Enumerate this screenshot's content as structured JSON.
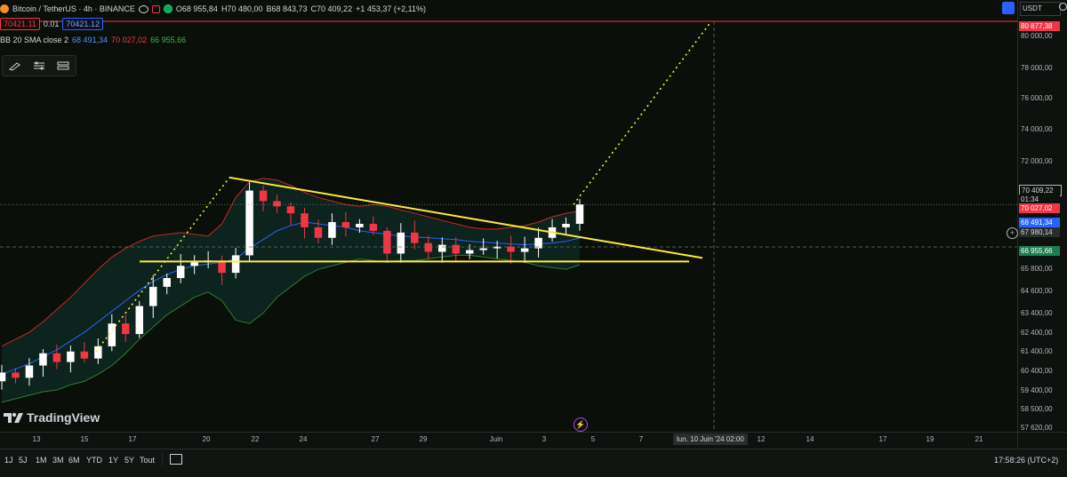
{
  "symbol": {
    "name": "Bitcoin / TetherUS",
    "interval": "4h",
    "exchange": "BINANCE",
    "header": "Bitcoin / TetherUS · 4h · BINANCE",
    "open": "O68 955,84",
    "high": "H70 480,00",
    "low": "B68 843,73",
    "close": "C70 409,22",
    "change": "+1 453,37 (+2,11%)"
  },
  "trade": {
    "sell": "70421.11",
    "spread": "0.01",
    "buy": "70421.12"
  },
  "indicator": {
    "label": "BB 20 SMA close 2",
    "basis": "68 491,34",
    "upper": "70 027,02",
    "lower": "66 955,66"
  },
  "currency": "USDT",
  "brand": "TradingView",
  "price_ticks": [
    "80 000,00",
    "78 000,00",
    "76 000,00",
    "74 000,00",
    "72 000,00",
    "65 800,00",
    "64 600,00",
    "63 400,00",
    "62 400,00",
    "61 400,00",
    "60 400,00",
    "59 400,00",
    "58 500,00",
    "57 620,00"
  ],
  "price_labels": {
    "alert": "80 877,38",
    "last": "70 409,22",
    "countdown": "01:34",
    "upper": "70 027,02",
    "basis": "68 491,34",
    "crosshair": "67 980,14",
    "lower": "66 955,66"
  },
  "time_ticks": [
    "13",
    "15",
    "17",
    "20",
    "22",
    "24",
    "27",
    "29",
    "Juin",
    "3",
    "5",
    "7",
    "12",
    "14",
    "17",
    "19",
    "21"
  ],
  "crosshair_time": "lun. 10 Juin '24   02:00",
  "timeframes": [
    "1J",
    "5J",
    "1M",
    "3M",
    "6M",
    "YTD",
    "1Y",
    "5Y",
    "Tout"
  ],
  "clock": "17:58:26 (UTC+2)",
  "colors": {
    "up": "#ffffff",
    "down": "#f23645",
    "basis": "#2962ff",
    "upper_band": "#c62828",
    "lower_band": "#2e7d32",
    "trendline": "#ffeb3b",
    "alert_line": "#f23645"
  },
  "icons": [
    "bitcoin-icon",
    "eye-icon",
    "alarm-icon",
    "brush-icon",
    "indicators-icon",
    "settings-lines-icon",
    "lightning-icon",
    "plus-icon",
    "layout-icon",
    "gear-icon"
  ],
  "chart_data": {
    "type": "candlestick",
    "symbol": "BTCUSDT",
    "timeframe": "4h",
    "ylim": [
      57620,
      80877.38
    ],
    "series": [
      {
        "name": "BB basis",
        "color": "#2962ff",
        "values": [
          60700,
          61000,
          61300,
          61700,
          62100,
          62600,
          63100,
          63700,
          64300,
          64900,
          65500,
          66000,
          66400,
          66700,
          66900,
          67000,
          67100,
          67300,
          67900,
          68400,
          68900,
          69200,
          69400,
          69300,
          69200,
          69100,
          68900,
          68800,
          68700,
          68600,
          68550,
          68500,
          68450,
          68400,
          68300,
          68250,
          68200,
          68150,
          68100,
          68150,
          68200,
          68300,
          68491
        ]
      },
      {
        "name": "BB upper",
        "color": "#c62828",
        "values": [
          62300,
          62700,
          63100,
          63700,
          64400,
          65100,
          65900,
          66700,
          67400,
          67900,
          68300,
          68600,
          68700,
          68800,
          68700,
          68600,
          69300,
          70800,
          71700,
          71900,
          71800,
          71500,
          71100,
          70800,
          70600,
          70400,
          70300,
          70400,
          70300,
          70100,
          69900,
          69700,
          69500,
          69300,
          69100,
          69000,
          69000,
          69100,
          69200,
          69400,
          69700,
          69900,
          70027
        ]
      },
      {
        "name": "BB lower",
        "color": "#2e7d32",
        "values": [
          59100,
          59300,
          59500,
          59700,
          59800,
          60100,
          60300,
          60700,
          61200,
          61900,
          62700,
          63400,
          64100,
          64600,
          65100,
          65400,
          64900,
          63800,
          63600,
          64200,
          65100,
          65700,
          66300,
          66700,
          66900,
          67100,
          67300,
          67200,
          67100,
          67200,
          67200,
          67300,
          67400,
          67500,
          67500,
          67400,
          67300,
          67200,
          67100,
          66900,
          66800,
          66700,
          66956
        ]
      }
    ],
    "annotations": [
      {
        "type": "trendline",
        "label": "descending resistance"
      },
      {
        "type": "horizontal",
        "label": "support",
        "value": 67150
      },
      {
        "type": "projection",
        "label": "dotted target",
        "value": 80877.38
      }
    ]
  }
}
